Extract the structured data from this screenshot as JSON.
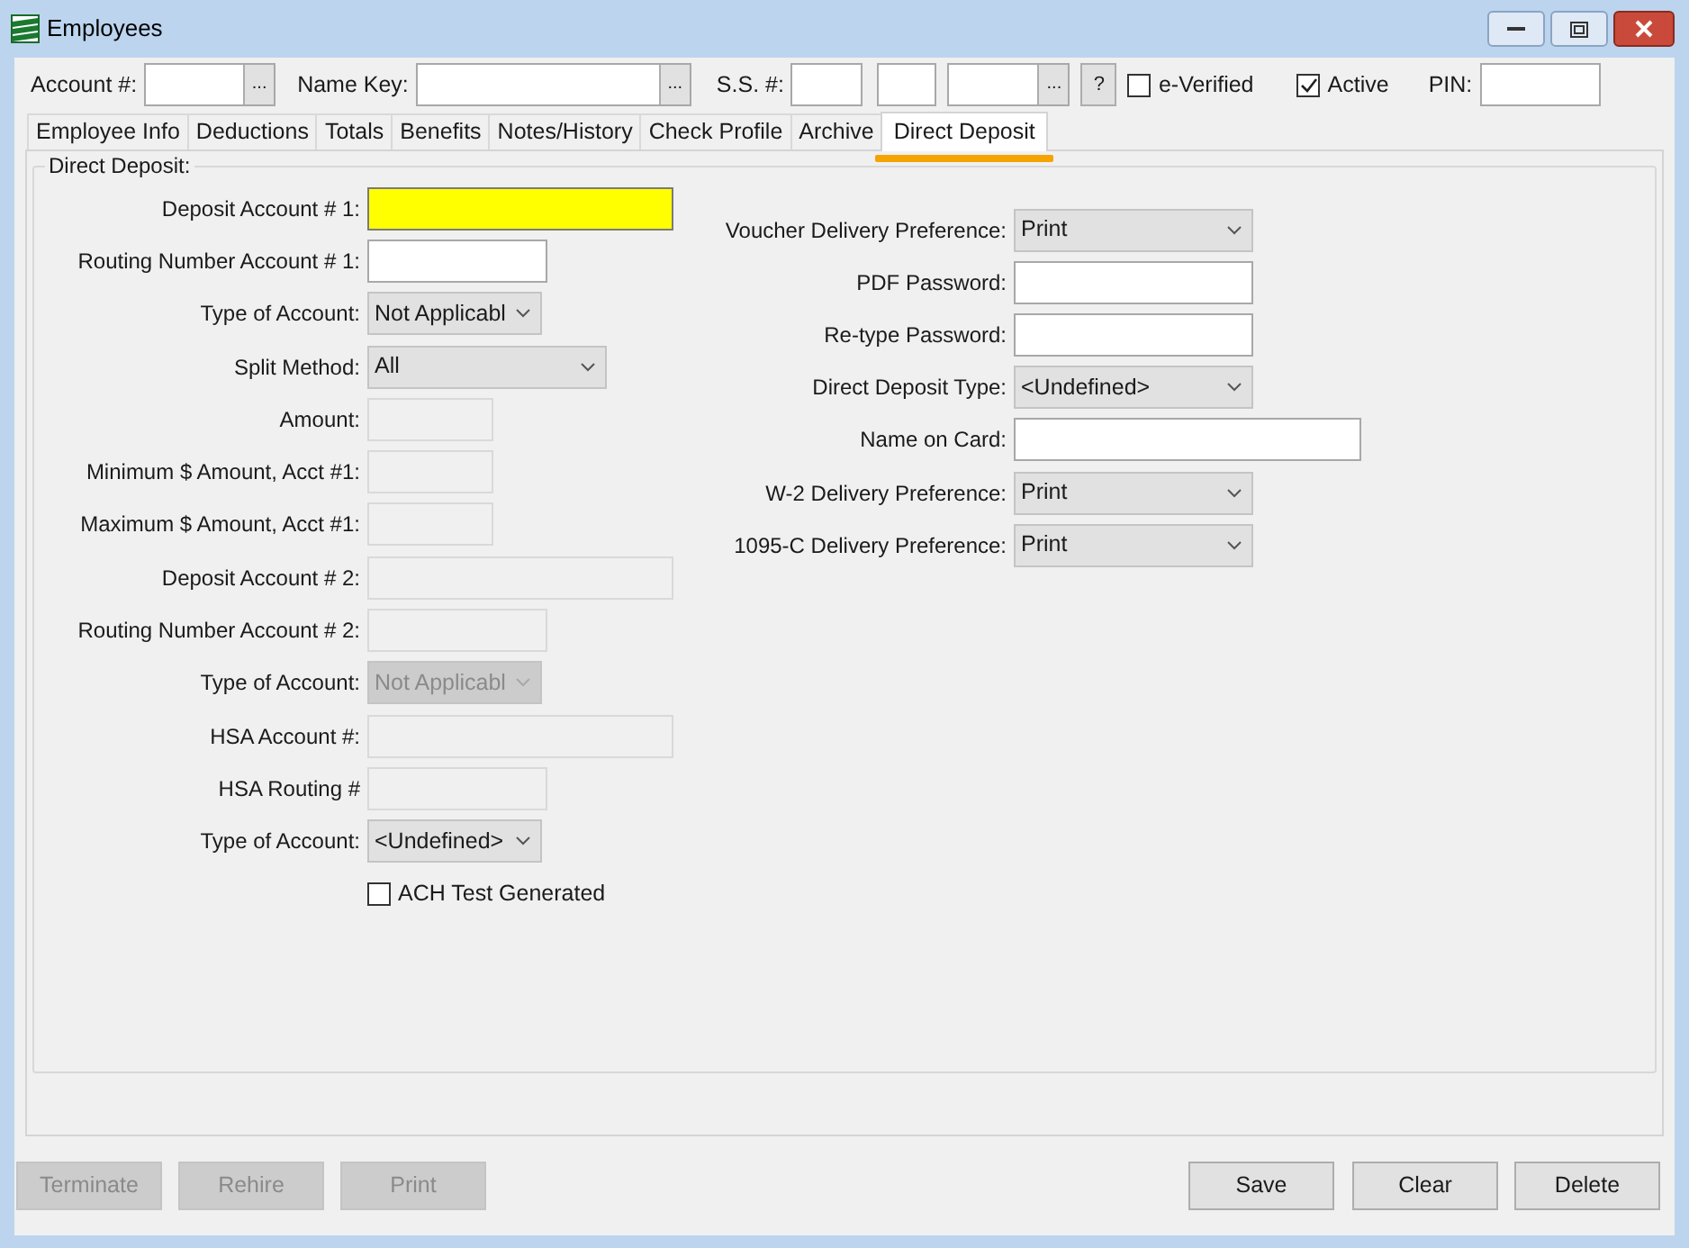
{
  "window": {
    "title": "Employees"
  },
  "header_fields": [
    {
      "kind": "field",
      "label": "Account #:",
      "button": "..."
    },
    {
      "kind": "field",
      "label": "Name Key:",
      "button": "..."
    },
    {
      "kind": "field",
      "label": "S.S. #:"
    },
    {
      "kind": "field"
    },
    {
      "kind": "field",
      "button": "..."
    },
    {
      "kind": "button",
      "label": "?"
    },
    {
      "kind": "checkbox",
      "label": "e-Verified",
      "checked": false
    },
    {
      "kind": "checkbox",
      "label": "Active",
      "checked": true
    },
    {
      "kind": "field",
      "label": "PIN:"
    }
  ],
  "tabs": [
    {
      "label": "Employee Info",
      "selected": false
    },
    {
      "label": "Deductions",
      "selected": false
    },
    {
      "label": "Totals",
      "selected": false
    },
    {
      "label": "Benefits",
      "selected": false
    },
    {
      "label": "Notes/History",
      "selected": false
    },
    {
      "label": "Check Profile",
      "selected": false
    },
    {
      "label": "Archive",
      "selected": false
    },
    {
      "label": "Direct Deposit",
      "selected": true
    }
  ],
  "group_title": "Direct Deposit:",
  "left_fields": [
    {
      "kind": "text",
      "label": "Deposit Account # 1:",
      "disabled": false,
      "highlighted": true
    },
    {
      "kind": "text",
      "label": "Routing Number Account # 1:",
      "disabled": false,
      "highlighted": false
    },
    {
      "kind": "select",
      "label": "Type of Account:",
      "value": "Not Applicabl",
      "disabled": false
    },
    {
      "kind": "select",
      "label": "Split Method:",
      "value": "All",
      "disabled": false
    },
    {
      "kind": "text",
      "label": "Amount:",
      "disabled": true,
      "highlighted": false
    },
    {
      "kind": "text",
      "label": "Minimum $ Amount, Acct #1:",
      "disabled": true,
      "highlighted": false
    },
    {
      "kind": "text",
      "label": "Maximum $ Amount, Acct #1:",
      "disabled": true,
      "highlighted": false
    },
    {
      "kind": "text",
      "label": "Deposit Account # 2:",
      "disabled": true,
      "highlighted": false
    },
    {
      "kind": "text",
      "label": "Routing Number Account # 2:",
      "disabled": true,
      "highlighted": false
    },
    {
      "kind": "select",
      "label": "Type of Account:",
      "value": "Not Applicabl",
      "disabled": true
    },
    {
      "kind": "text",
      "label": "HSA Account #:",
      "disabled": true,
      "highlighted": false
    },
    {
      "kind": "text",
      "label": "HSA Routing #",
      "disabled": true,
      "highlighted": false
    },
    {
      "kind": "select",
      "label": "Type of Account:",
      "value": "<Undefined>",
      "disabled": false
    },
    {
      "kind": "checkbox",
      "label": "ACH Test Generated",
      "checked": false
    }
  ],
  "right_fields": [
    {
      "kind": "select",
      "label": "Voucher Delivery Preference:",
      "value": "Print",
      "disabled": false
    },
    {
      "kind": "text",
      "label": "PDF Password:",
      "disabled": false,
      "highlighted": false
    },
    {
      "kind": "text",
      "label": "Re-type Password:",
      "disabled": false,
      "highlighted": false
    },
    {
      "kind": "select",
      "label": "Direct Deposit Type:",
      "value": "<Undefined>",
      "disabled": false
    },
    {
      "kind": "text",
      "label": "Name on Card:",
      "disabled": false,
      "highlighted": false
    },
    {
      "kind": "select",
      "label": "W-2 Delivery Preference:",
      "value": "Print",
      "disabled": false
    },
    {
      "kind": "select",
      "label": "1095-C Delivery Preference:",
      "value": "Print",
      "disabled": false
    }
  ],
  "buttons": [
    {
      "label": "Terminate",
      "disabled": true
    },
    {
      "label": "Rehire",
      "disabled": true
    },
    {
      "label": "Print",
      "disabled": true
    },
    {
      "label": "Save",
      "disabled": false
    },
    {
      "label": "Clear",
      "disabled": false
    },
    {
      "label": "Delete",
      "disabled": false
    }
  ]
}
